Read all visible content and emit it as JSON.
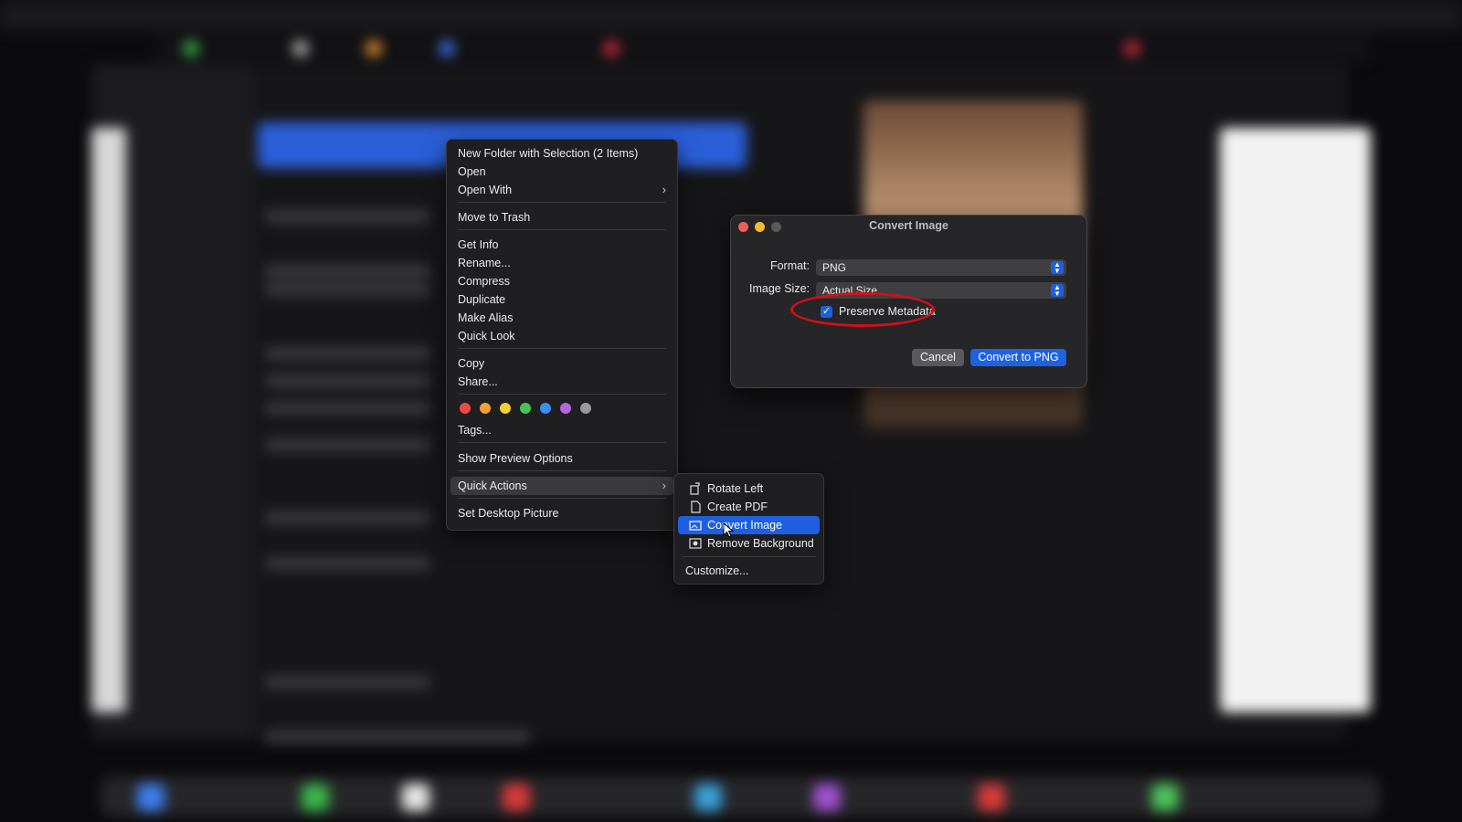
{
  "context_menu": {
    "items": [
      {
        "label": "New Folder with Selection (2 Items)"
      },
      {
        "label": "Open"
      },
      {
        "label": "Open With"
      },
      {
        "label": "Move to Trash"
      },
      {
        "label": "Get Info"
      },
      {
        "label": "Rename..."
      },
      {
        "label": "Compress"
      },
      {
        "label": "Duplicate"
      },
      {
        "label": "Make Alias"
      },
      {
        "label": "Quick Look"
      },
      {
        "label": "Copy"
      },
      {
        "label": "Share..."
      },
      {
        "label": "Tags..."
      },
      {
        "label": "Show Preview Options"
      },
      {
        "label": "Quick Actions"
      },
      {
        "label": "Set Desktop Picture"
      }
    ],
    "tag_colors": [
      "#ec4a45",
      "#f3a23a",
      "#f2cf33",
      "#4cc25a",
      "#3d8ef0",
      "#b466e0",
      "#9a9a9c"
    ]
  },
  "quick_actions_submenu": {
    "items": [
      {
        "label": "Rotate Left",
        "icon": "rotate-left-icon"
      },
      {
        "label": "Create PDF",
        "icon": "document-icon"
      },
      {
        "label": "Convert Image",
        "icon": "photo-icon"
      },
      {
        "label": "Remove Background",
        "icon": "photo-remove-bg-icon"
      }
    ],
    "customize_label": "Customize...",
    "selected": "Convert Image"
  },
  "dialog": {
    "title": "Convert Image",
    "format_label": "Format:",
    "format_value": "PNG",
    "size_label": "Image Size:",
    "size_value": "Actual Size",
    "preserve_metadata_label": "Preserve Metadata",
    "preserve_metadata_checked": true,
    "cancel_label": "Cancel",
    "convert_label": "Convert to PNG",
    "accent_color": "#1d63e0",
    "annotation_color": "#d0101a"
  }
}
